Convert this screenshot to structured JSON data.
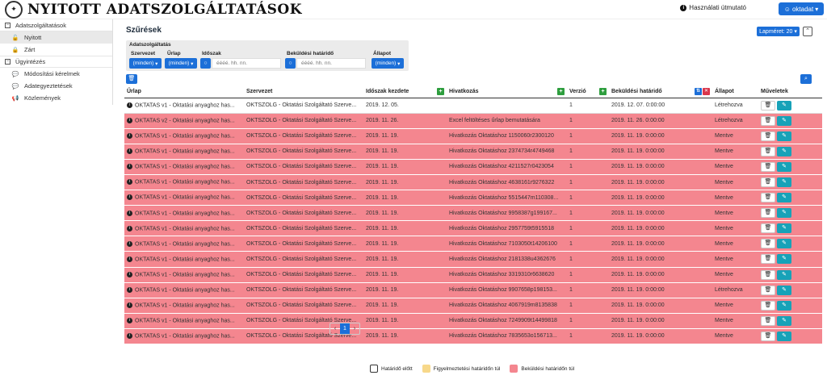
{
  "header": {
    "title": "NYITOTT ADATSZOLGÁLTATÁSOK",
    "help_label": "Használati útmutató",
    "user_label": "oktadat"
  },
  "sidebar": {
    "groups": [
      {
        "label": "Adatszolgáltatások",
        "items": [
          {
            "label": "Nyitott",
            "icon": "unlock-icon",
            "active": true
          },
          {
            "label": "Zárt",
            "icon": "lock-icon",
            "active": false
          }
        ]
      },
      {
        "label": "Ügyintézés",
        "items": [
          {
            "label": "Módosítási kérelmek",
            "icon": "chat-icon"
          },
          {
            "label": "Adategyeztetések",
            "icon": "chat-icon"
          },
          {
            "label": "Közlemények",
            "icon": "megaphone-icon"
          }
        ]
      }
    ]
  },
  "filters": {
    "title": "Szűrések",
    "page_size_label": "Lapméret: 20",
    "group_label": "Adatszolgáltatás",
    "szervezet_label": "Szervezet",
    "szervezet_value": "(minden)",
    "urlap_label": "Űrlap",
    "urlap_value": "(minden)",
    "idoszak_label": "Időszak",
    "idoszak_placeholder": "éééé. hh. nn.",
    "bekuldesi_label": "Beküldési határidő",
    "bekuldesi_placeholder": "éééé. hh. nn.",
    "allapot_label": "Állapot",
    "allapot_value": "(minden)"
  },
  "table": {
    "headers": [
      "Űrlap",
      "Szervezet",
      "Időszak kezdete",
      "Hivatkozás",
      "Verzió",
      "Beküldési határidő",
      "Állapot",
      "Műveletek"
    ],
    "rows": [
      {
        "status": "white",
        "urlap": "OKTATAS v1 - Oktatási anyaghoz has...",
        "szervezet": "OKTSZOLG - Oktatási Szolgáltató Szerve...",
        "idoszak": "2019. 12. 05.",
        "hivatkozas": "",
        "verzio": "1",
        "hatarido": "2019. 12. 07. 0:00:00",
        "allapot": "Létrehozva"
      },
      {
        "status": "red",
        "urlap": "OKTATAS v2 - Oktatási anyaghoz has...",
        "szervezet": "OKTSZOLG - Oktatási Szolgáltató Szerve...",
        "idoszak": "2019. 11. 26.",
        "hivatkozas": "Excel feltöltéses űrlap bemutatására",
        "verzio": "1",
        "hatarido": "2019. 11. 26. 0:00:00",
        "allapot": "Létrehozva"
      },
      {
        "status": "red",
        "urlap": "OKTATAS v1 - Oktatási anyaghoz has...",
        "szervezet": "OKTSZOLG - Oktatási Szolgáltató Szerve...",
        "idoszak": "2019. 11. 19.",
        "hivatkozas": "Hivatkozás Oktatáshoz 1150060r2300120",
        "verzio": "1",
        "hatarido": "2019. 11. 19. 0:00:00",
        "allapot": "Mentve"
      },
      {
        "status": "red",
        "urlap": "OKTATAS v1 - Oktatási anyaghoz has...",
        "szervezet": "OKTSZOLG - Oktatási Szolgáltató Szerve...",
        "idoszak": "2019. 11. 19.",
        "hivatkozas": "Hivatkozás Oktatáshoz 2374734r4749468",
        "verzio": "1",
        "hatarido": "2019. 11. 19. 0:00:00",
        "allapot": "Mentve"
      },
      {
        "status": "red",
        "urlap": "OKTATAS v1 - Oktatási anyaghoz has...",
        "szervezet": "OKTSZOLG - Oktatási Szolgáltató Szerve...",
        "idoszak": "2019. 11. 19.",
        "hivatkozas": "Hivatkozás Oktatáshoz 4211527r0423054",
        "verzio": "1",
        "hatarido": "2019. 11. 19. 0:00:00",
        "allapot": "Mentve"
      },
      {
        "status": "red",
        "urlap": "OKTATAS v1 - Oktatási anyaghoz has...",
        "szervezet": "OKTSZOLG - Oktatási Szolgáltató Szerve...",
        "idoszak": "2019. 11. 19.",
        "hivatkozas": "Hivatkozás Oktatáshoz 4638161r9276322",
        "verzio": "1",
        "hatarido": "2019. 11. 19. 0:00:00",
        "allapot": "Mentve"
      },
      {
        "status": "red",
        "urlap": "OKTATAS v1 - Oktatási anyaghoz has...",
        "szervezet": "OKTSZOLG - Oktatási Szolgáltató Szerve...",
        "idoszak": "2019. 11. 19.",
        "hivatkozas": "Hivatkozás Oktatáshoz 5515447m110308...",
        "verzio": "1",
        "hatarido": "2019. 11. 19. 0:00:00",
        "allapot": "Mentve"
      },
      {
        "status": "red",
        "urlap": "OKTATAS v1 - Oktatási anyaghoz has...",
        "szervezet": "OKTSZOLG - Oktatási Szolgáltató Szerve...",
        "idoszak": "2019. 11. 19.",
        "hivatkozas": "Hivatkozás Oktatáshoz 9958387g199167...",
        "verzio": "1",
        "hatarido": "2019. 11. 19. 0:00:00",
        "allapot": "Mentve"
      },
      {
        "status": "red",
        "urlap": "OKTATAS v1 - Oktatási anyaghoz has...",
        "szervezet": "OKTSZOLG - Oktatási Szolgáltató Szerve...",
        "idoszak": "2019. 11. 19.",
        "hivatkozas": "Hivatkozás Oktatáshoz 2957759t5915518",
        "verzio": "1",
        "hatarido": "2019. 11. 19. 0:00:00",
        "allapot": "Mentve"
      },
      {
        "status": "red",
        "urlap": "OKTATAS v1 - Oktatási anyaghoz has...",
        "szervezet": "OKTSZOLG - Oktatási Szolgáltató Szerve...",
        "idoszak": "2019. 11. 19.",
        "hivatkozas": "Hivatkozás Oktatáshoz 7103050t14206100",
        "verzio": "1",
        "hatarido": "2019. 11. 19. 0:00:00",
        "allapot": "Mentve"
      },
      {
        "status": "red",
        "urlap": "OKTATAS v1 - Oktatási anyaghoz has...",
        "szervezet": "OKTSZOLG - Oktatási Szolgáltató Szerve...",
        "idoszak": "2019. 11. 19.",
        "hivatkozas": "Hivatkozás Oktatáshoz 2181338u4362676",
        "verzio": "1",
        "hatarido": "2019. 11. 19. 0:00:00",
        "allapot": "Mentve"
      },
      {
        "status": "red",
        "urlap": "OKTATAS v1 - Oktatási anyaghoz has...",
        "szervezet": "OKTSZOLG - Oktatási Szolgáltató Szerve...",
        "idoszak": "2019. 11. 19.",
        "hivatkozas": "Hivatkozás Oktatáshoz 3319310r6638620",
        "verzio": "1",
        "hatarido": "2019. 11. 19. 0:00:00",
        "allapot": "Mentve"
      },
      {
        "status": "red",
        "urlap": "OKTATAS v1 - Oktatási anyaghoz has...",
        "szervezet": "OKTSZOLG - Oktatási Szolgáltató Szerve...",
        "idoszak": "2019. 11. 19.",
        "hivatkozas": "Hivatkozás Oktatáshoz 9907658p198153...",
        "verzio": "1",
        "hatarido": "2019. 11. 19. 0:00:00",
        "allapot": "Létrehozva"
      },
      {
        "status": "red",
        "urlap": "OKTATAS v1 - Oktatási anyaghoz has...",
        "szervezet": "OKTSZOLG - Oktatási Szolgáltató Szerve...",
        "idoszak": "2019. 11. 19.",
        "hivatkozas": "Hivatkozás Oktatáshoz 4067919m8135838",
        "verzio": "1",
        "hatarido": "2019. 11. 19. 0:00:00",
        "allapot": "Mentve"
      },
      {
        "status": "red",
        "urlap": "OKTATAS v1 - Oktatási anyaghoz has...",
        "szervezet": "OKTSZOLG - Oktatási Szolgáltató Szerve...",
        "idoszak": "2019. 11. 19.",
        "hivatkozas": "Hivatkozás Oktatáshoz 7249909t14499818",
        "verzio": "1",
        "hatarido": "2019. 11. 19. 0:00:00",
        "allapot": "Mentve"
      },
      {
        "status": "red",
        "urlap": "OKTATAS v1 - Oktatási anyaghoz has...",
        "szervezet": "OKTSZOLG - Oktatási Szolgáltató Szerve...",
        "idoszak": "2019. 11. 19.",
        "hivatkozas": "Hivatkozás Oktatáshoz 7835653o156713...",
        "verzio": "1",
        "hatarido": "2019. 11. 19. 0:00:00",
        "allapot": "Mentve"
      }
    ]
  },
  "pager": {
    "prev": "‹",
    "current": "1",
    "next": "›"
  },
  "legend": [
    {
      "label": "Határidő előtt",
      "color": "#ffffff"
    },
    {
      "label": "Figyelmeztetési határidőn túl",
      "color": "#f7d88a"
    },
    {
      "label": "Beküldési határidőn túl",
      "color": "#f4868f"
    }
  ],
  "colors": {
    "accent": "#1c6fd8",
    "overdue": "#f4868f",
    "edit": "#17a2b8",
    "sort_add": "#2e9e3e"
  }
}
